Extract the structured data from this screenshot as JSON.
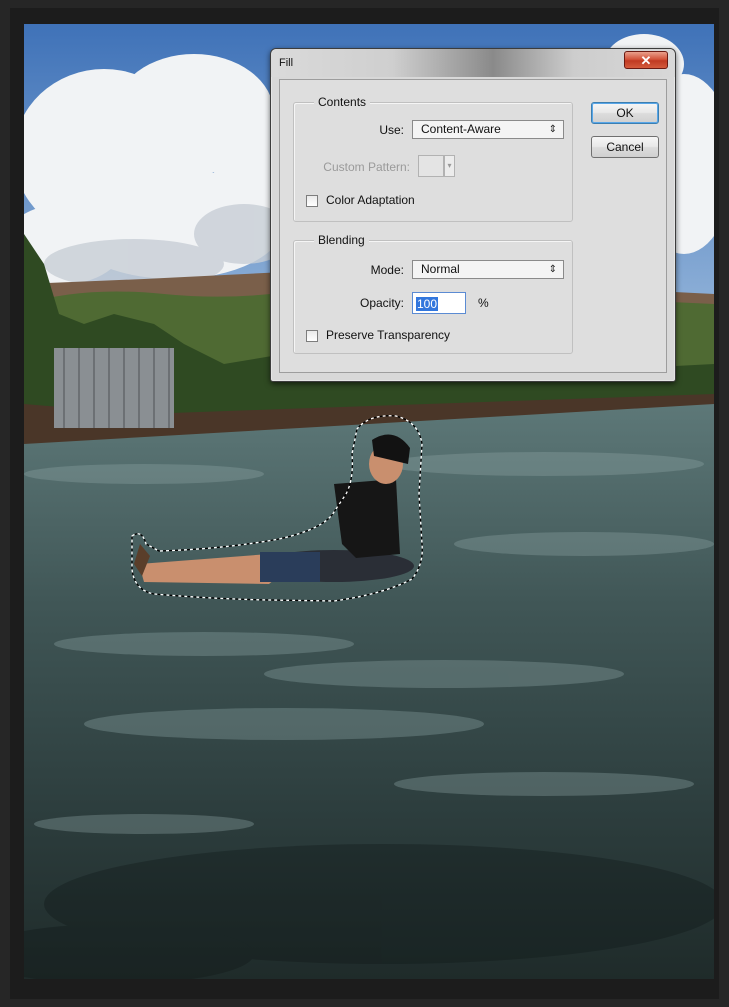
{
  "dialog": {
    "title": "Fill",
    "close_glyph": "✕",
    "contents": {
      "group_label": "Contents",
      "use_label": "Use:",
      "use_value": "Content-Aware",
      "custom_pattern_label": "Custom Pattern:",
      "color_adaptation_label": "Color Adaptation",
      "color_adaptation_checked": false
    },
    "blending": {
      "group_label": "Blending",
      "mode_label": "Mode:",
      "mode_value": "Normal",
      "opacity_label": "Opacity:",
      "opacity_value": "100",
      "opacity_unit": "%",
      "preserve_transparency_label": "Preserve Transparency",
      "preserve_transparency_checked": false
    },
    "buttons": {
      "ok": "OK",
      "cancel": "Cancel"
    }
  },
  "icons": {
    "select_arrow": "⇕",
    "close": "close-icon"
  },
  "colors": {
    "workspace_bg": "#262626",
    "selection_highlight": "#3377dd",
    "close_button": "#c8442a"
  }
}
